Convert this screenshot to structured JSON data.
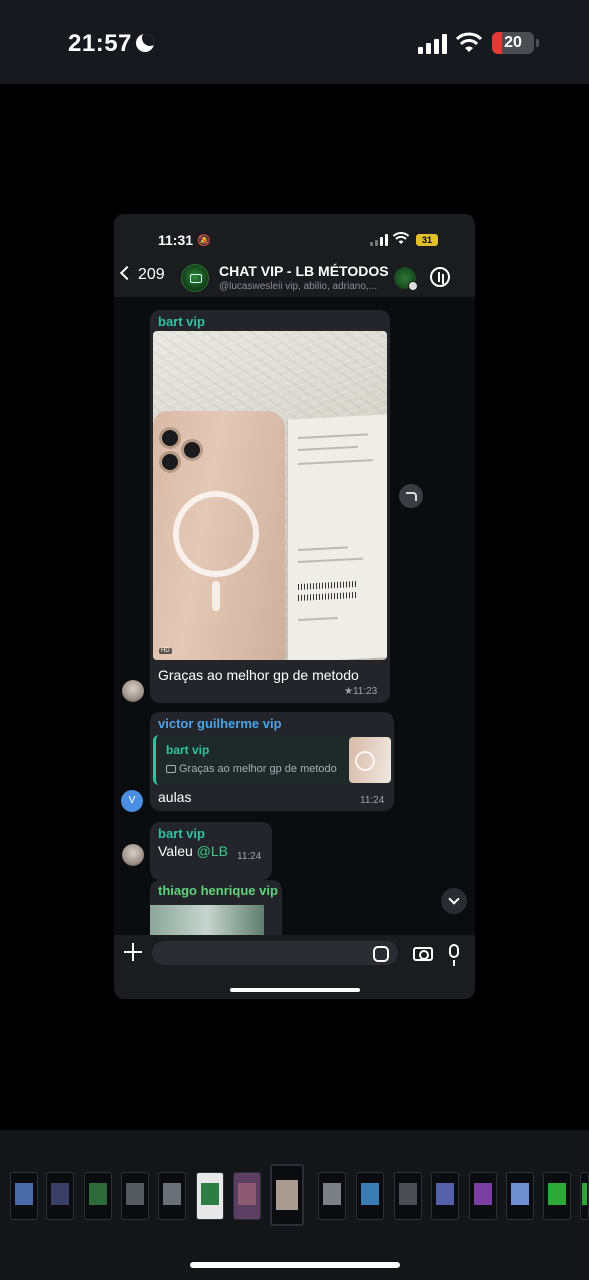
{
  "outer_status": {
    "time": "21:57",
    "battery": "20"
  },
  "inner_status": {
    "time": "11:31",
    "battery": "31"
  },
  "chat_header": {
    "back_count": "209",
    "title": "CHAT VIP - LB MÉTODOS",
    "subtitle": "@lucaswesleii vip, abilio, adriano,..."
  },
  "messages": {
    "m1": {
      "sender": "bart vip",
      "text": "Graças ao melhor gp de metodo",
      "time": "★11:23",
      "photo_badge": "HD"
    },
    "m2": {
      "sender": "victor guilherme vip",
      "avatar_letter": "V",
      "reply_name": "bart vip",
      "reply_text": "Graças ao melhor gp de metodo",
      "text": "aulas",
      "time": "11:24"
    },
    "m3": {
      "sender": "bart vip",
      "text_prefix": "Valeu ",
      "mention": "@LB",
      "time": "11:24"
    },
    "m4": {
      "sender": "thiago henrique vip"
    }
  },
  "composer": {
    "placeholder": ""
  },
  "colors": {
    "sender_teal": "#2fc3a2",
    "sender_blue": "#4aa3e8",
    "sender_green": "#5fd47a",
    "mention": "#3cc98a",
    "bubble": "#23252a",
    "battery_low": "#e53935",
    "inner_battery": "#e0c12a"
  },
  "icons": [
    "moon-icon",
    "signal-icon",
    "wifi-icon",
    "battery-icon",
    "mute-bell-icon",
    "back-chevron-icon",
    "group-avatar",
    "voice-chat-icon",
    "share-icon",
    "camera-icon",
    "scroll-down-icon",
    "plus-icon",
    "sticker-icon",
    "mic-icon"
  ]
}
